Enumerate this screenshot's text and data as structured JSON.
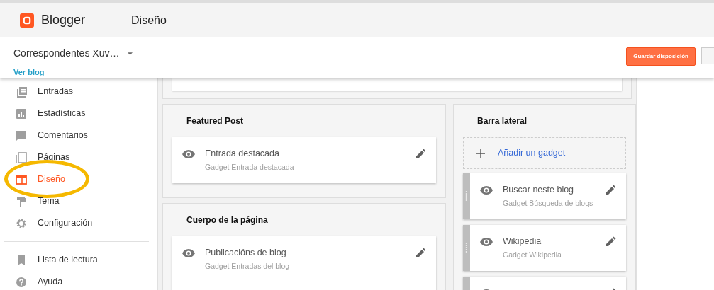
{
  "header": {
    "brand": "Blogger",
    "page_title": "Diseño"
  },
  "blog": {
    "name": "Correspondentes Xuv…",
    "view_link": "Ver blog"
  },
  "toolbar": {
    "save_button": "Guardar disposición"
  },
  "nav": [
    {
      "items": [
        {
          "label": "Entradas",
          "selected": false,
          "circled": false
        },
        {
          "label": "Estadísticas",
          "selected": false,
          "circled": false
        },
        {
          "label": "Comentarios",
          "selected": false,
          "circled": false
        },
        {
          "label": "Páginas",
          "selected": false,
          "circled": false
        },
        {
          "label": "Diseño",
          "selected": true,
          "circled": true
        },
        {
          "label": "Tema",
          "selected": false,
          "circled": false
        },
        {
          "label": "Configuración",
          "selected": false,
          "circled": false
        }
      ]
    },
    {
      "items": [
        {
          "label": "Lista de lectura",
          "selected": false,
          "circled": false
        },
        {
          "label": "Ayuda",
          "selected": false,
          "circled": false
        }
      ]
    }
  ],
  "columns": [
    {
      "sections": [
        {
          "title": "Featured Post",
          "gadgets": [
            {
              "title": "Entrada destacada",
              "subtitle": "Gadget Entrada destacada",
              "draggable": false
            }
          ]
        },
        {
          "title": "Cuerpo de la página",
          "gadgets": [
            {
              "title": "Publicacións de blog",
              "subtitle": "Gadget Entradas del blog",
              "draggable": false
            }
          ]
        }
      ]
    },
    {
      "sections": [
        {
          "title": "Barra lateral",
          "add_gadget": "Añadir un gadget",
          "gadgets": [
            {
              "title": "Buscar neste blog",
              "subtitle": "Gadget Búsqueda de blogs",
              "draggable": true
            },
            {
              "title": "Wikipedia",
              "subtitle": "Gadget Wikipedia",
              "draggable": true
            },
            {
              "draggable": true
            }
          ]
        }
      ]
    }
  ]
}
